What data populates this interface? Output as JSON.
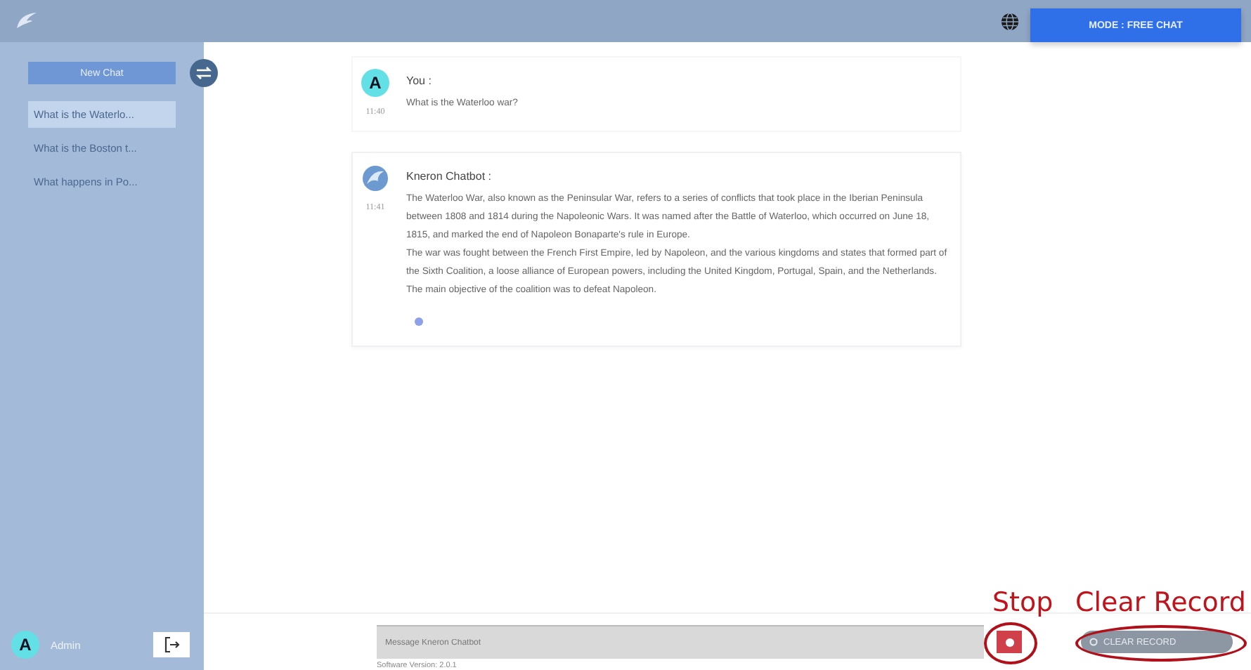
{
  "header": {
    "mode_button": "MODE : FREE CHAT"
  },
  "sidebar": {
    "new_chat": "New Chat",
    "history": [
      {
        "label": "What is the Waterlo...",
        "selected": true
      },
      {
        "label": "What is the Boston t...",
        "selected": false
      },
      {
        "label": "What happens in Po...",
        "selected": false
      }
    ],
    "user": {
      "initial": "A",
      "name": "Admin"
    }
  },
  "messages": [
    {
      "kind": "user",
      "initial": "A",
      "sender": "You :",
      "time": "11:40",
      "paragraphs": [
        "What is the Waterloo war?"
      ],
      "typing": false
    },
    {
      "kind": "bot",
      "sender": "Kneron Chatbot :",
      "time": "11:41",
      "paragraphs": [
        "The Waterloo War, also known as the Peninsular War, refers to a series of conflicts that took place in the Iberian Peninsula between 1808 and 1814 during the Napoleonic Wars. It was named after the Battle of Waterloo, which occurred on June 18, 1815, and marked the end of Napoleon Bonaparte's rule in Europe.",
        "The war was fought between the French First Empire, led by Napoleon, and the various kingdoms and states that formed part of the Sixth Coalition, a loose alliance of European powers, including the United Kingdom, Portugal, Spain, and the Netherlands. The main objective of the coalition was to defeat Napoleon."
      ],
      "typing": true
    }
  ],
  "composer": {
    "placeholder": "Message Kneron Chatbot",
    "clear_button": "CLEAR RECORD",
    "version": "Software Version: 2.0.1"
  },
  "annotations": [
    "Stop",
    "Clear Record"
  ]
}
